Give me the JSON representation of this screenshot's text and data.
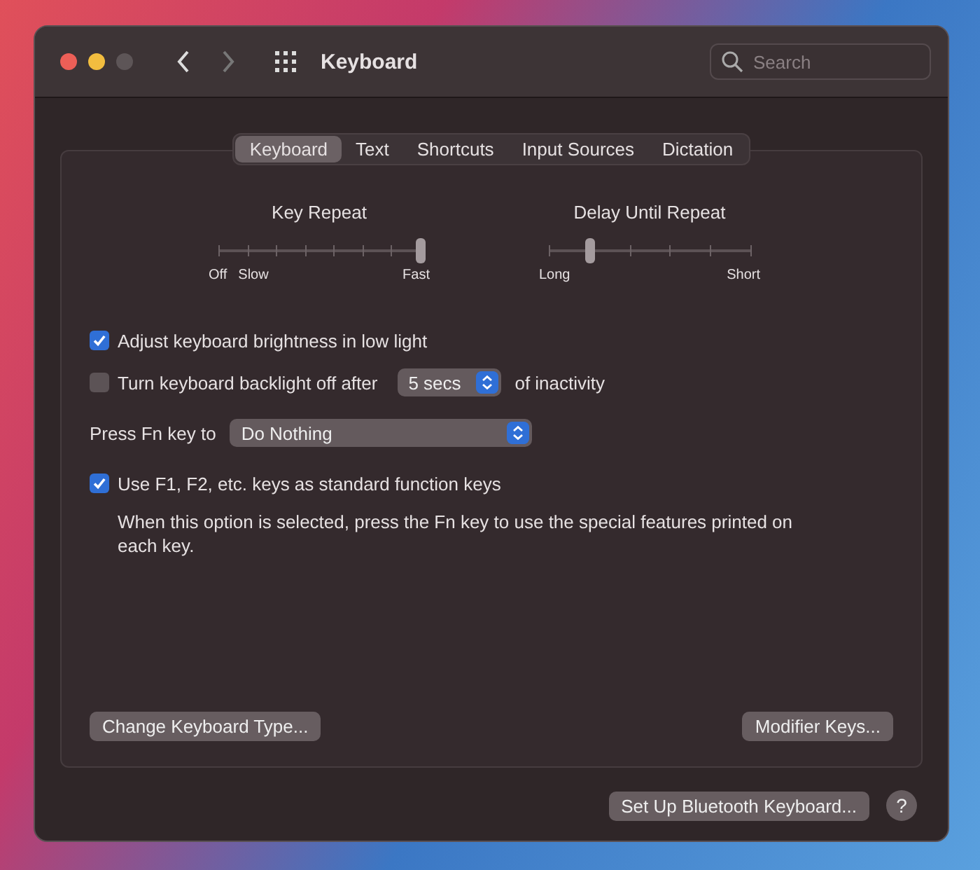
{
  "window": {
    "title": "Keyboard",
    "search": {
      "placeholder": "Search"
    }
  },
  "tabs": [
    {
      "label": "Keyboard",
      "selected": true
    },
    {
      "label": "Text",
      "selected": false
    },
    {
      "label": "Shortcuts",
      "selected": false
    },
    {
      "label": "Input Sources",
      "selected": false
    },
    {
      "label": "Dictation",
      "selected": false
    }
  ],
  "sliders": [
    {
      "kind": "rate",
      "title": "Key Repeat",
      "level": 1,
      "labels": [
        "Off",
        "Slow",
        "Fast"
      ]
    },
    {
      "kind": "delay",
      "title": "Delay Until Repeat",
      "level": 0.2,
      "labels": [
        "Long",
        "Short"
      ]
    }
  ],
  "options": [
    {
      "kind": "checkbox",
      "checked": true,
      "label": "Adjust keyboard brightness in low light"
    },
    {
      "kind": "checkbox",
      "checked": false,
      "label": "Turn keyboard backlight off after",
      "popup": "5 secs",
      "suffix": "of inactivity"
    },
    {
      "kind": "popup",
      "label": "Press Fn key to",
      "popup": "Do Nothing"
    },
    {
      "kind": "checkbox",
      "checked": true,
      "label": "Use F1, F2, etc. keys as standard function keys",
      "note": "When this option is selected, press the Fn key to use the special features printed on each key."
    }
  ],
  "panel_buttons": [
    "Change Keyboard Type...",
    "Modifier Keys..."
  ],
  "footer": {
    "button": "Set Up Bluetooth Keyboard...",
    "help": "?"
  }
}
